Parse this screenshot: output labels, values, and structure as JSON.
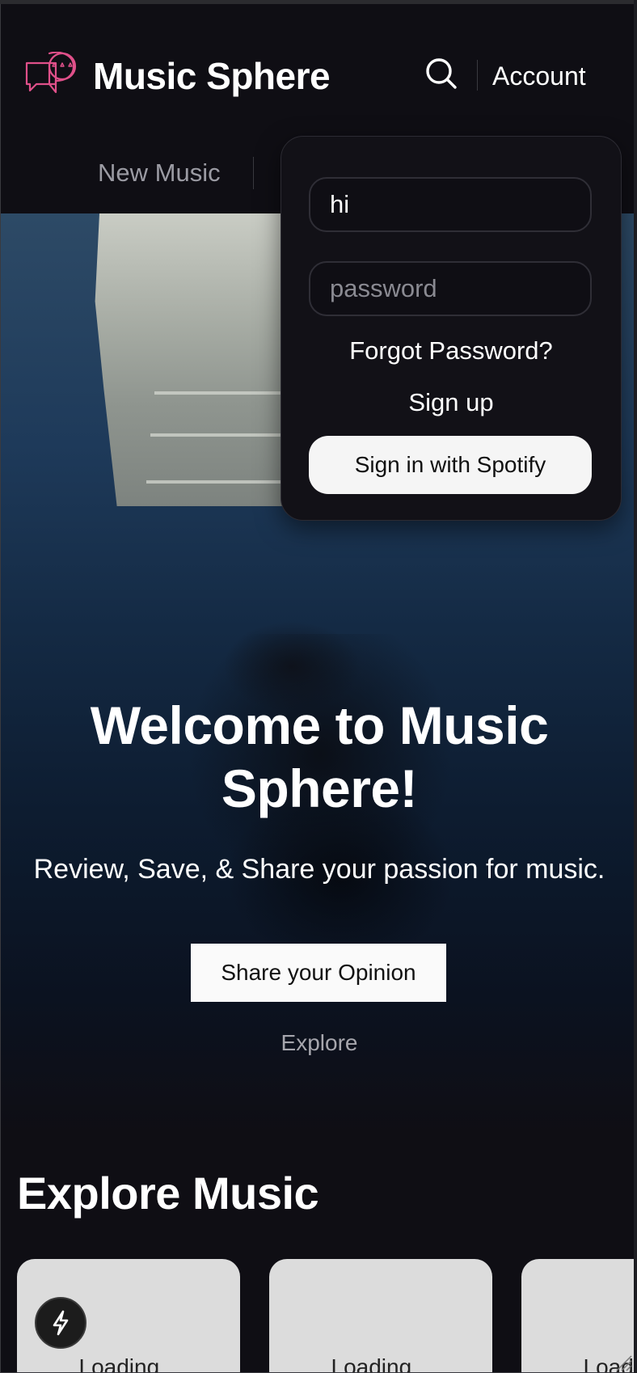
{
  "header": {
    "brand": "Music Sphere",
    "account_label": "Account",
    "nav": [
      "New Music"
    ]
  },
  "login": {
    "username_value": "hi",
    "password_placeholder": "password",
    "forgot_label": "Forgot Password?",
    "signup_label": "Sign up",
    "spotify_label": "Sign in with Spotify"
  },
  "hero": {
    "title": "Welcome to Music Sphere!",
    "subtitle": "Review, Save, & Share your passion for music.",
    "cta_label": "Share your Opinion",
    "explore_label": "Explore"
  },
  "explore": {
    "title": "Explore Music",
    "cards": [
      {
        "label": "Loading..."
      },
      {
        "label": "Loading..."
      },
      {
        "label": "Loading..."
      }
    ]
  },
  "colors": {
    "background": "#0f0e14",
    "logo_accent": "#e0508a",
    "card_bg": "#dcdcdc"
  },
  "icons": {
    "logo": "chat-bubbles-stars-icon",
    "search": "search-icon",
    "fab": "lightning-bolt-icon"
  }
}
